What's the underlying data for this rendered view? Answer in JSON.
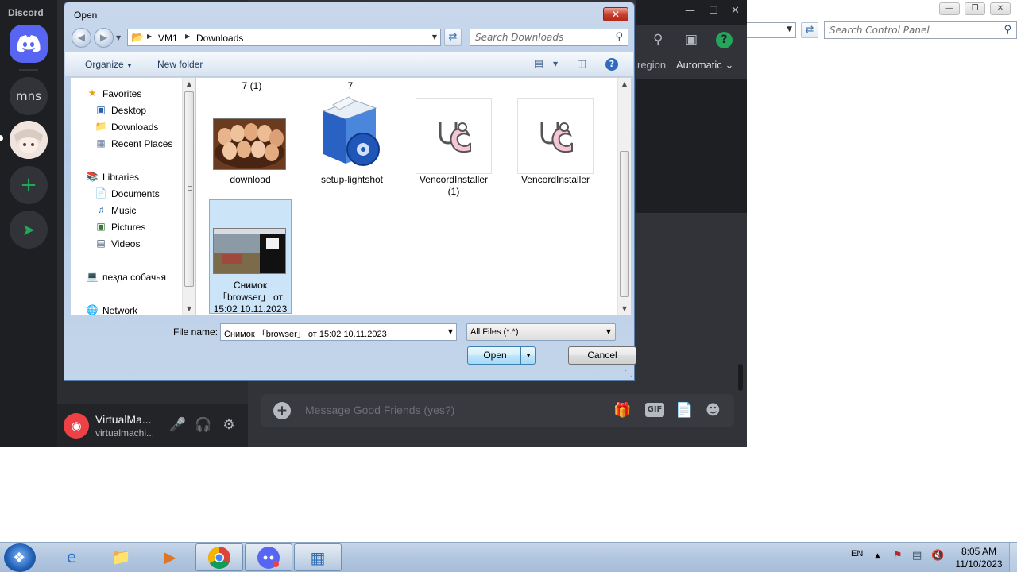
{
  "control_panel": {
    "search_placeholder": "Search Control Panel"
  },
  "discord": {
    "app_name": "Discord",
    "servers": [
      {
        "label": "mns"
      }
    ],
    "header": {
      "region_text": "region",
      "automatic_text": "Automatic"
    },
    "user": {
      "name": "VirtualMa...",
      "subtext": "virtualmachi..."
    },
    "composer": {
      "placeholder": "Message Good Friends (yes?)",
      "gif_label": "GIF"
    },
    "colors": {
      "rail": "#1e1f22",
      "sidebar": "#2b2d31",
      "main": "#313338",
      "blurple": "#5865f2",
      "green": "#23a55a"
    }
  },
  "dialog": {
    "title": "Open",
    "address": {
      "crumbs": [
        "VM1",
        "Downloads"
      ]
    },
    "search_placeholder": "Search Downloads",
    "toolbar": {
      "organize_label": "Organize",
      "new_folder_label": "New folder"
    },
    "nav": {
      "favorites_header": "Favorites",
      "favorites": [
        "Desktop",
        "Downloads",
        "Recent Places"
      ],
      "libraries_header": "Libraries",
      "libraries": [
        "Documents",
        "Music",
        "Pictures",
        "Videos"
      ],
      "homegroup_label": "пезда собачья",
      "network_label": "Network"
    },
    "files": {
      "cut_labels": [
        "7 (1)",
        "7"
      ],
      "items": [
        {
          "name": "download"
        },
        {
          "name": "setup-lightshot"
        },
        {
          "name": "VencordInstaller (1)",
          "line1": "VencordInstaller",
          "line2": "(1)"
        },
        {
          "name": "VencordInstaller"
        },
        {
          "name": "Снимок「browser」 от 15:02 10.11.2023",
          "line1": "Снимок",
          "line2": "「browser」 от",
          "line3": "15:02  10.11.2023",
          "selected": true
        }
      ]
    },
    "file_name_label": "File name:",
    "file_name_value": "Снимок 「browser」 от 15:02  10.11.2023",
    "filter_value": "All Files (*.*)",
    "open_label": "Open",
    "cancel_label": "Cancel"
  },
  "taskbar": {
    "apps": [
      "Internet Explorer",
      "Windows Explorer",
      "Media Player",
      "Google Chrome",
      "Discord",
      "Control Panel"
    ],
    "language": "EN",
    "clock_time": "8:05 AM",
    "clock_date": "11/10/2023"
  }
}
